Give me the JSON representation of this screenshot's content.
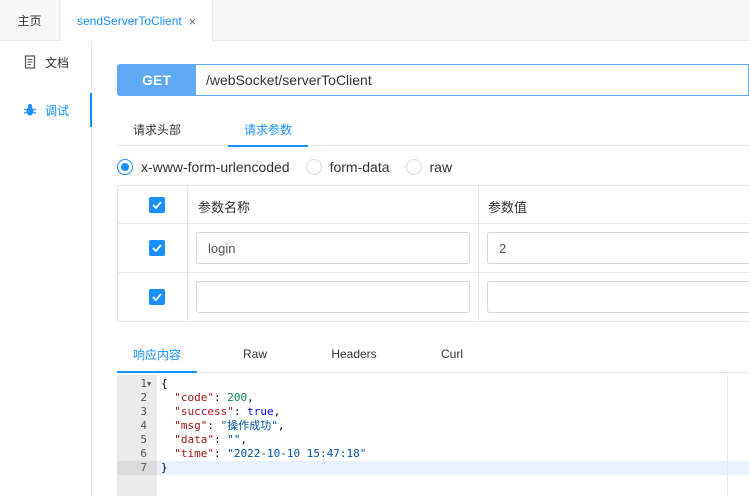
{
  "tabs": {
    "home_label": "主页",
    "active_label": "sendServerToClient",
    "close_glyph": "×"
  },
  "sidebar": {
    "items": [
      {
        "label": "文档",
        "icon": "document-icon",
        "active": false
      },
      {
        "label": "调试",
        "icon": "bug-icon",
        "active": true
      }
    ]
  },
  "request": {
    "method": "GET",
    "url": "/webSocket/serverToClient",
    "tabs": [
      {
        "label": "请求头部",
        "active": false
      },
      {
        "label": "请求参数",
        "active": true
      }
    ],
    "body_types": [
      {
        "label": "x-www-form-urlencoded",
        "selected": true
      },
      {
        "label": "form-data",
        "selected": false
      },
      {
        "label": "raw",
        "selected": false
      }
    ],
    "params_table": {
      "header_name": "参数名称",
      "header_value": "参数值",
      "rows": [
        {
          "checked": true,
          "name": "login",
          "value": "2"
        },
        {
          "checked": true,
          "name": "",
          "value": ""
        }
      ]
    }
  },
  "response": {
    "tabs": [
      {
        "label": "响应内容",
        "active": true
      },
      {
        "label": "Raw",
        "active": false
      },
      {
        "label": "Headers",
        "active": false
      },
      {
        "label": "Curl",
        "active": false
      }
    ],
    "line_numbers": [
      "1",
      "2",
      "3",
      "4",
      "5",
      "6",
      "7"
    ],
    "code": {
      "open": "{",
      "code_key": "\"code\"",
      "code_val": "200",
      "success_key": "\"success\"",
      "success_val": "true",
      "msg_key": "\"msg\"",
      "msg_val": "\"操作成功\"",
      "data_key": "\"data\"",
      "data_val": "\"\"",
      "time_key": "\"time\"",
      "time_val": "\"2022-10-10 15:47:18\"",
      "close": "}"
    }
  },
  "colors": {
    "accent": "#1890ff",
    "method_bg": "#5fa9f5"
  }
}
